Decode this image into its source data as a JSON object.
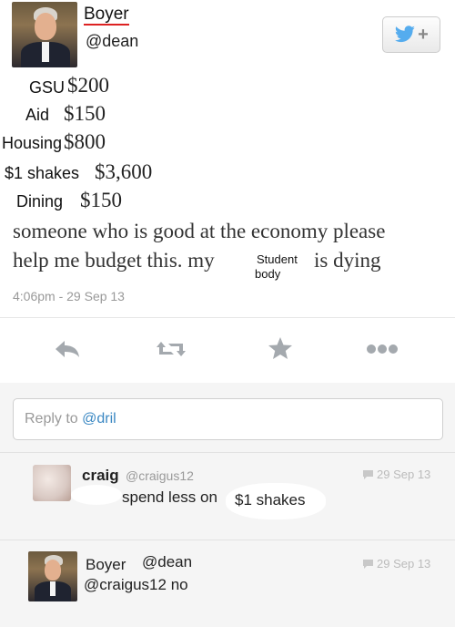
{
  "tweet": {
    "display_name": "Boyer",
    "handle": "@dean",
    "budget": [
      {
        "label": "GSU",
        "amount": "$200"
      },
      {
        "label": "Aid",
        "amount": "$150"
      },
      {
        "label": "Housing",
        "amount": "$800"
      },
      {
        "label": "$1 shakes",
        "amount": "$3,600"
      },
      {
        "label": "Dining",
        "amount": "$150"
      }
    ],
    "text_line1": "someone who is good at the economy please",
    "text_line2_a": "help me budget this. my",
    "text_insert_1": "Student",
    "text_insert_2": "body",
    "text_line2_b": "is dying",
    "timestamp": "4:06pm - 29 Sep 13"
  },
  "actions": {
    "reply_icon": "reply-icon",
    "retweet_icon": "retweet-icon",
    "favorite_icon": "star-icon",
    "more_icon": "more-icon"
  },
  "reply_box": {
    "prefix": "Reply to ",
    "mention": "@dril"
  },
  "replies": [
    {
      "name": "craig",
      "handle": "@craigus12",
      "time": "29 Sep 13",
      "body_a": "spend less on",
      "body_b": "$1 shakes"
    },
    {
      "name": "Boyer",
      "handle": "@dean",
      "time": "29 Sep 13",
      "body": "@craigus12 no"
    }
  ],
  "colors": {
    "accent": "#3b88c3",
    "muted": "#999999",
    "twitter_blue": "#55acee"
  }
}
